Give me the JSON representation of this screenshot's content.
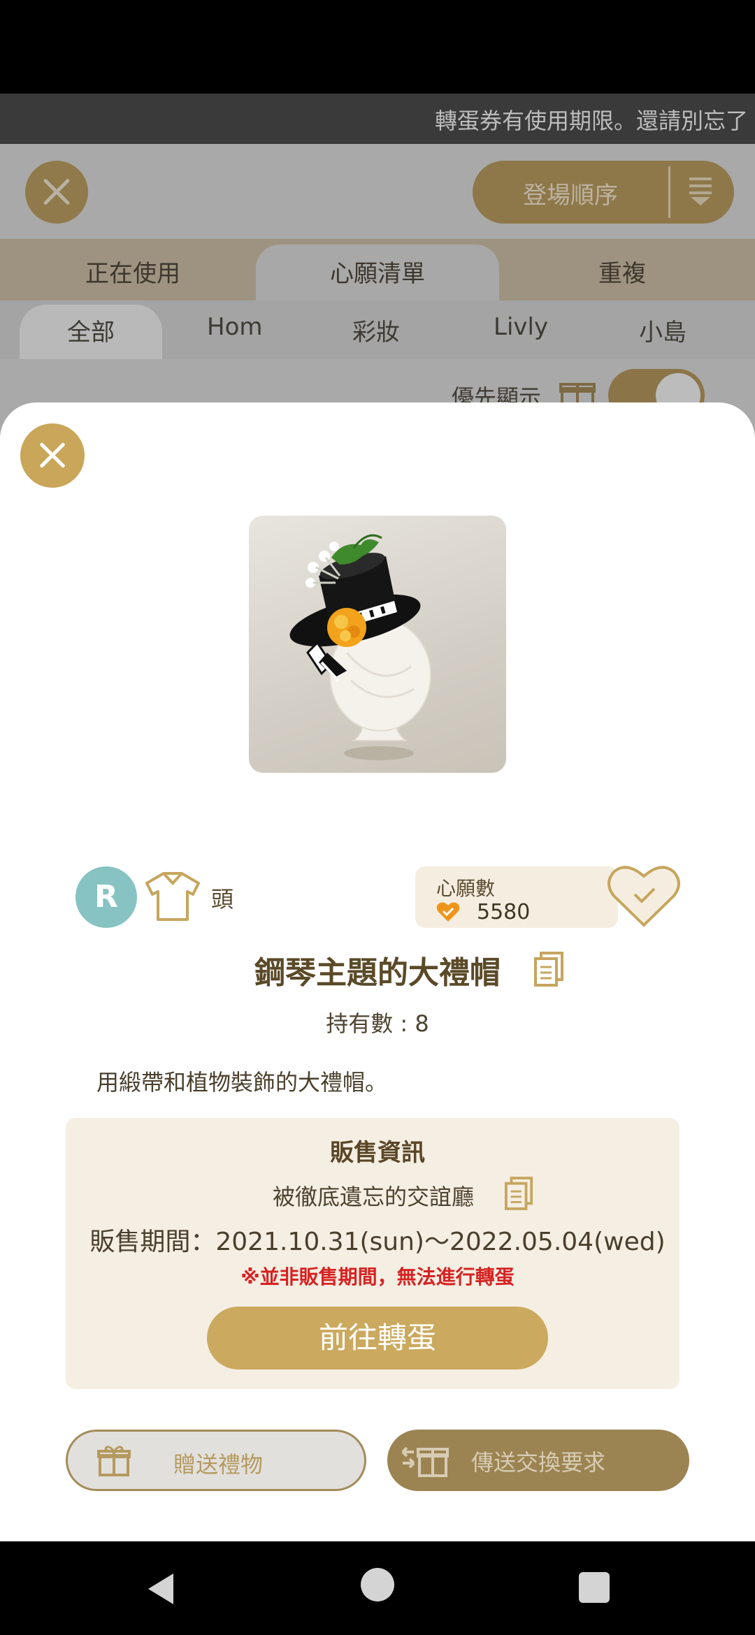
{
  "notice": {
    "text": "轉蛋券有使用期限。還請別忘了"
  },
  "background": {
    "sort_label": "登場順序",
    "tabs": [
      {
        "label": "正在使用"
      },
      {
        "label": "心願清單"
      },
      {
        "label": "重複"
      }
    ],
    "subtabs": [
      {
        "label": "全部"
      },
      {
        "label": "Hom"
      },
      {
        "label": "彩妝"
      },
      {
        "label": "Livly"
      },
      {
        "label": "小島"
      }
    ],
    "priority_label": "優先顯示"
  },
  "item": {
    "rarity": "R",
    "category": "頭",
    "wish_label": "心願數",
    "wish_count": "5580",
    "name": "鋼琴主題的大禮帽",
    "owned": "持有數 : 8",
    "description": "用緞帶和植物裝飾的大禮帽。"
  },
  "sale": {
    "title": "販售資訊",
    "place": "被徹底遺忘的交誼廳",
    "period": "販售期間：2021.10.31(sun)～2022.05.04(wed)",
    "warning": "※並非販售期間，無法進行轉蛋",
    "goto_label": "前往轉蛋"
  },
  "actions": {
    "gift_label": "贈送禮物",
    "trade_label": "傳送交換要求"
  },
  "colors": {
    "accent_gold": "#c9a659",
    "rarity_teal": "#86c3c2",
    "warning_red": "#d62222"
  }
}
